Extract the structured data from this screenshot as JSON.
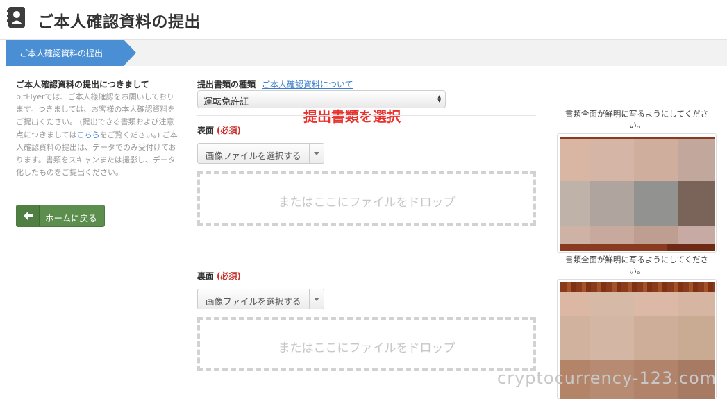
{
  "header": {
    "title": "ご本人確認資料の提出",
    "icon": "contact-card-icon"
  },
  "steps": {
    "current": "ご本人確認資料の提出",
    "color": "#4a8fd3"
  },
  "sidebar": {
    "heading": "ご本人確認資料の提出につきまして",
    "text_before_link": "bitFlyerでは、ご本人様確認をお願いしております。つきましては、お客様の本人確認資料をご提出ください。 (提出できる書類および注意点につきましては",
    "link_text": "こちら",
    "text_after_link": "をご覧ください。) ご本人確認資料の提出は、データでのみ受付けております。書類をスキャンまたは撮影し、データ化したものをご提出ください。",
    "home_button": "ホームに戻る",
    "home_button_icon": "arrow-left-icon"
  },
  "form": {
    "doc_type_label": "提出書類の種類",
    "doc_type_link": "ご本人確認資料について",
    "doc_type_value": "運転免許証",
    "annotation": "提出書類を選択",
    "front": {
      "label": "表面",
      "required": "(必須)",
      "file_button": "画像ファイルを選択する",
      "drop_text": "またはここにファイルをドロップ"
    },
    "back": {
      "label": "裏面",
      "required": "(必須)",
      "file_button": "画像ファイルを選択する",
      "drop_text": "またはここにファイルをドロップ"
    }
  },
  "samples": {
    "caption_line1": "書類全面が鮮明に写るようにしてくださ",
    "caption_line2": "い。"
  },
  "watermark": "cryptocurrency-123.com"
}
